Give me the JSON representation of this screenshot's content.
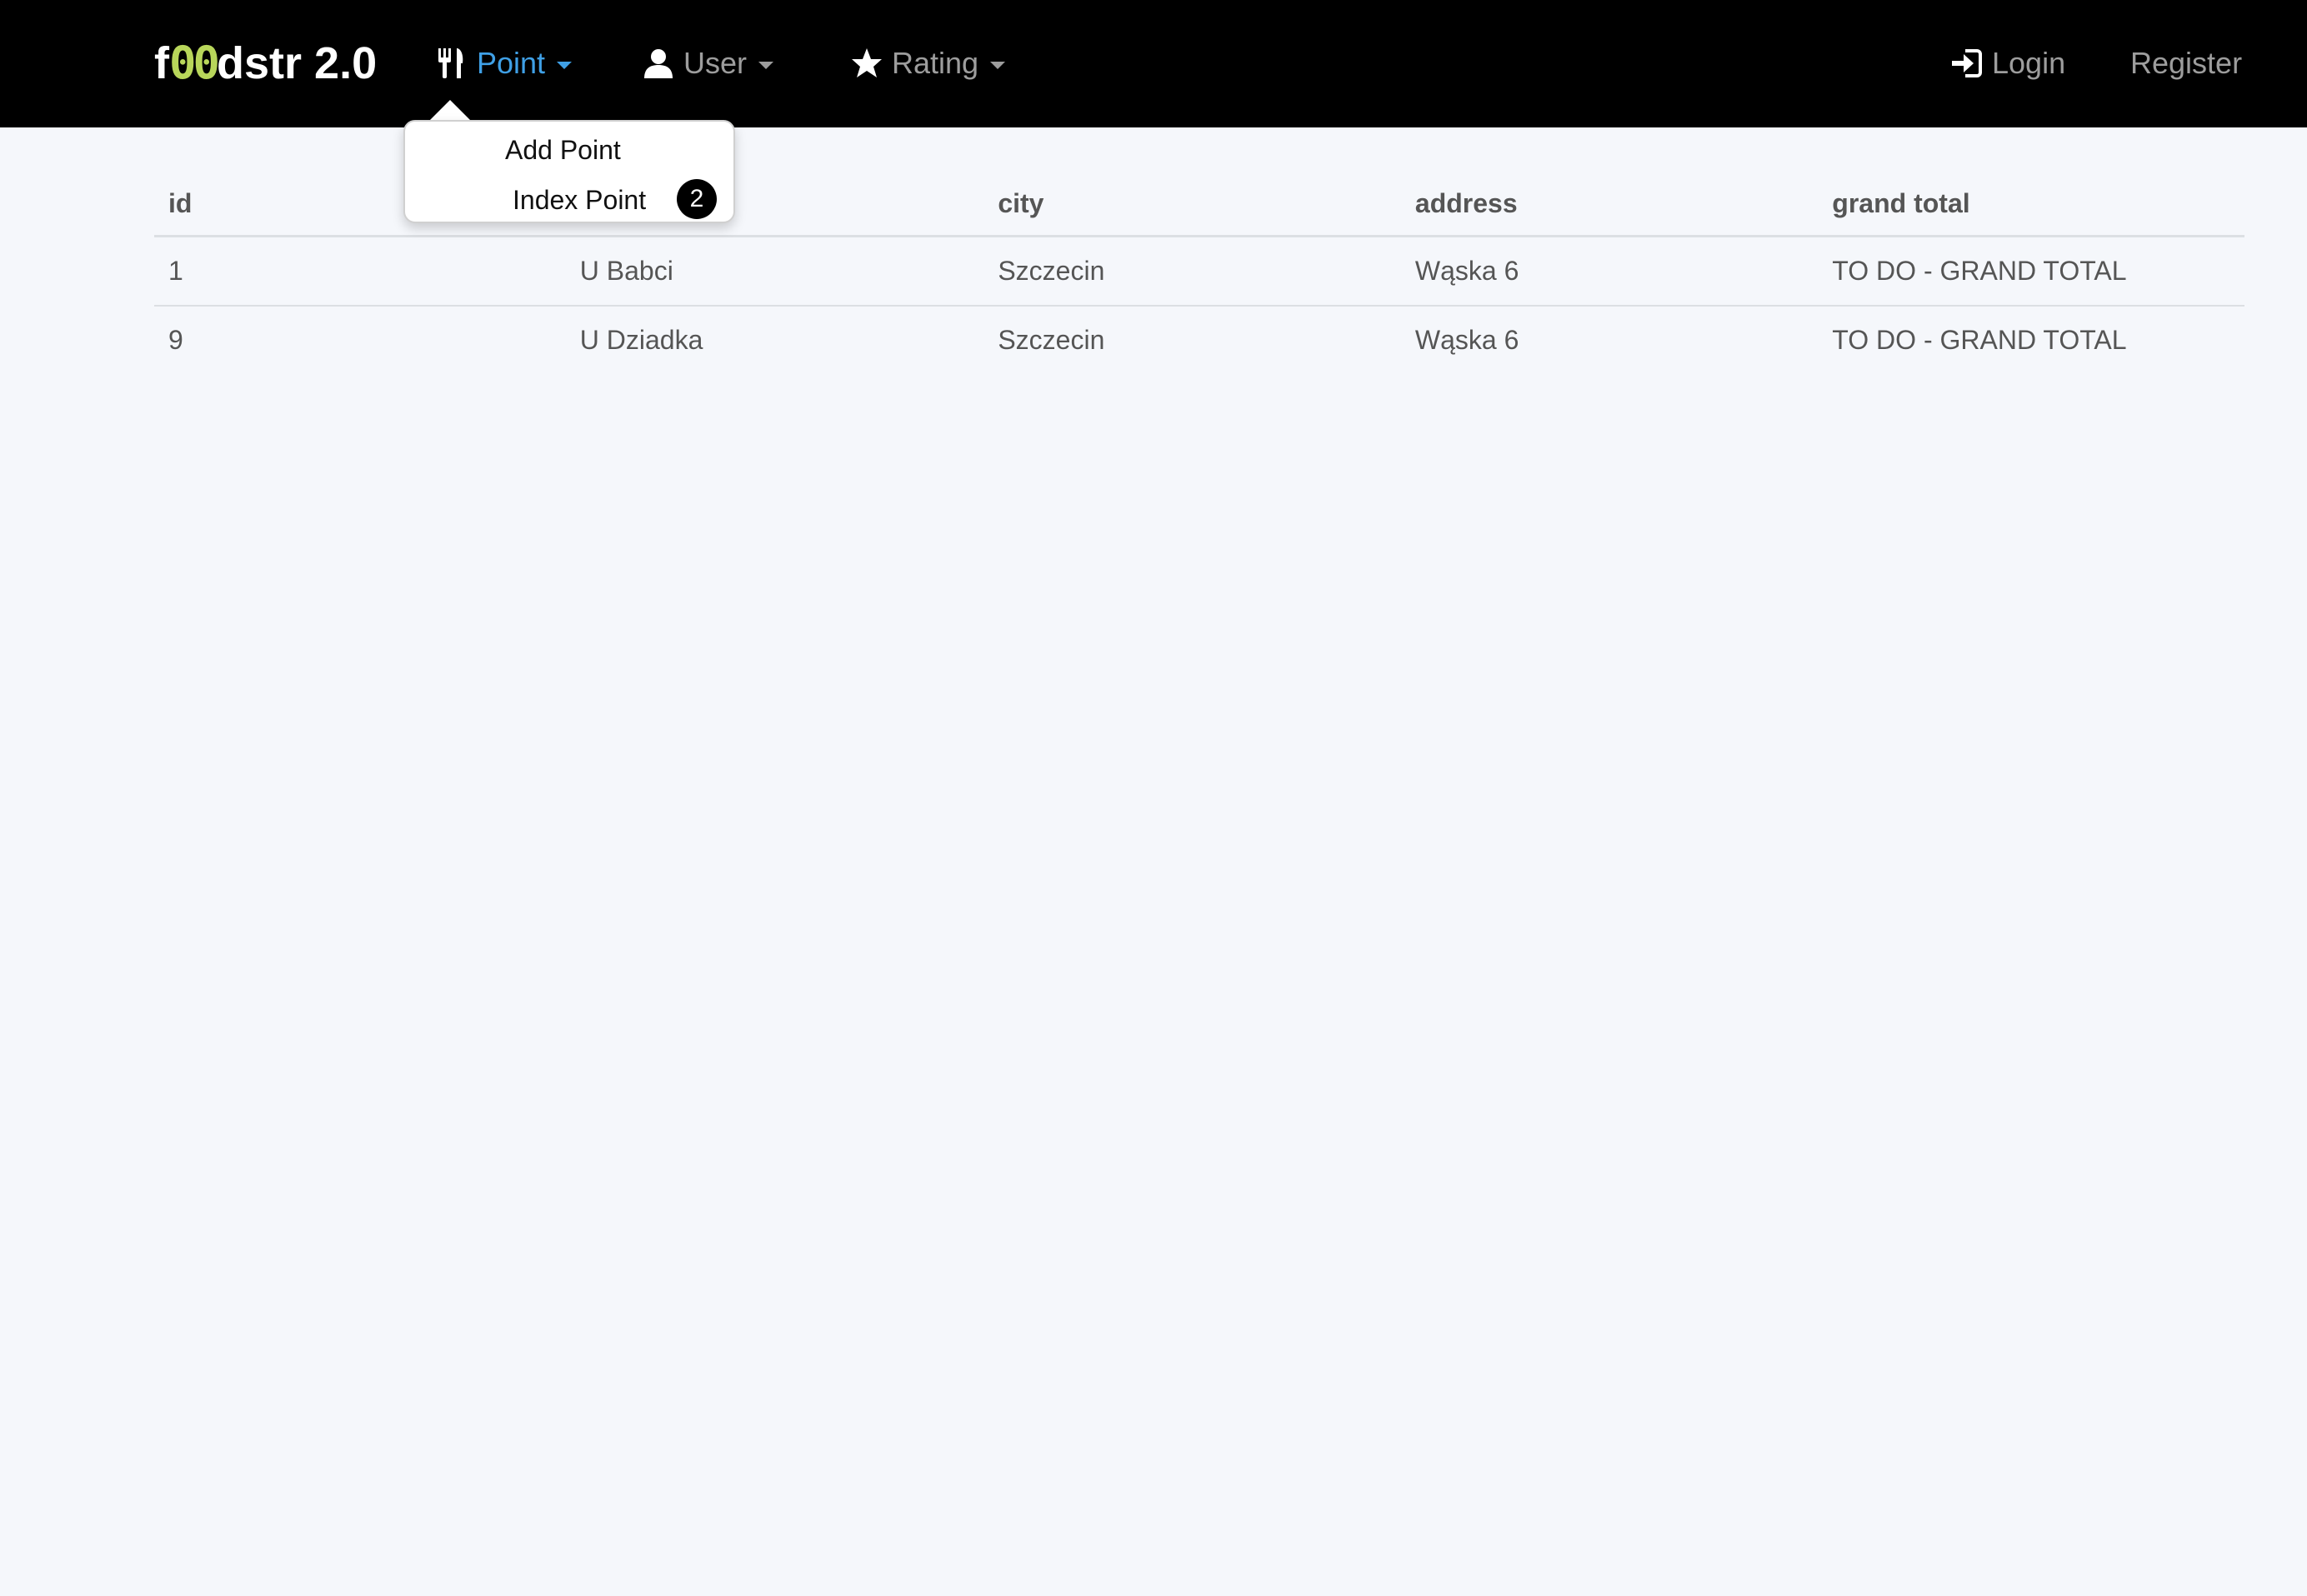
{
  "brand": {
    "prefix": "f",
    "zeros": "00",
    "suffix": "dstr 2.0"
  },
  "nav": {
    "point": {
      "label": "Point",
      "icon": "cutlery-icon"
    },
    "user": {
      "label": "User",
      "icon": "user-icon"
    },
    "rating": {
      "label": "Rating",
      "icon": "star-icon"
    },
    "login": {
      "label": "Login",
      "icon": "login-icon"
    },
    "register": {
      "label": "Register"
    }
  },
  "dropdown": {
    "items": [
      {
        "label": "Add Point"
      },
      {
        "label": "Index Point",
        "badge": "2"
      }
    ]
  },
  "table": {
    "headers": [
      "id",
      "",
      "city",
      "address",
      "grand total"
    ],
    "rows": [
      [
        "1",
        "U Babci",
        "Szczecin",
        "Wąska 6",
        "TO DO - GRAND TOTAL"
      ],
      [
        "9",
        "U Dziadka",
        "Szczecin",
        "Wąska 6",
        "TO DO - GRAND TOTAL"
      ]
    ]
  },
  "colors": {
    "navbar": "#000000",
    "active": "#3fa0e6",
    "brand_accent": "#b8d65a",
    "page_background": "#f5f7fb"
  }
}
